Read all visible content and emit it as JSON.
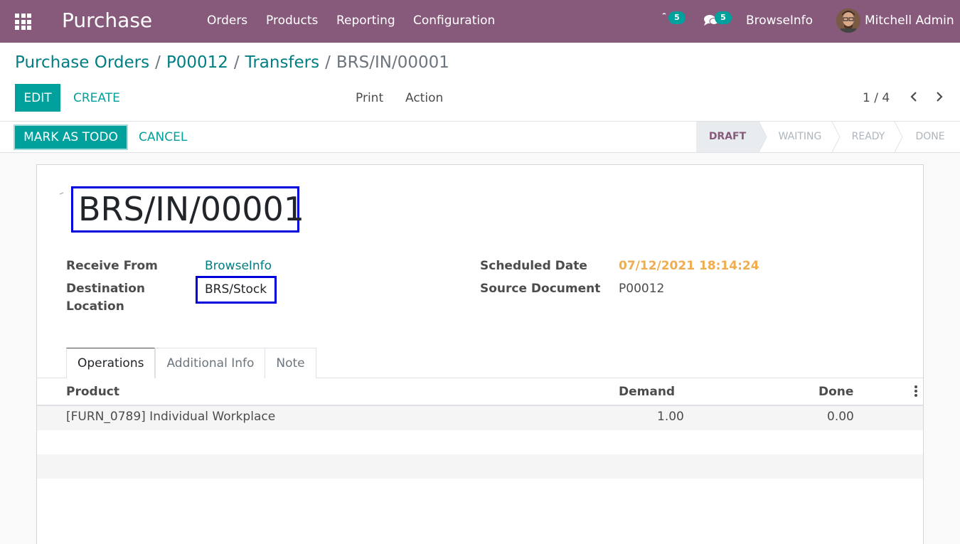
{
  "navbar": {
    "app_name": "Purchase",
    "menu": [
      "Orders",
      "Products",
      "Reporting",
      "Configuration"
    ],
    "activity_count": "5",
    "messages_count": "5",
    "company": "BrowseInfo",
    "user": "Mitchell Admin"
  },
  "breadcrumb": {
    "items": [
      "Purchase Orders",
      "P00012",
      "Transfers"
    ],
    "separator": "/",
    "current": "BRS/IN/00001"
  },
  "control_panel": {
    "edit_label": "EDIT",
    "create_label": "CREATE",
    "print_label": "Print",
    "action_label": "Action",
    "pager": "1 / 4"
  },
  "statusbar": {
    "mark_todo_label": "MARK AS TODO",
    "cancel_label": "CANCEL",
    "stages": [
      "DRAFT",
      "WAITING",
      "READY",
      "DONE"
    ],
    "active_stage": "DRAFT"
  },
  "form": {
    "title": "BRS/IN/00001",
    "receive_from_label": "Receive From",
    "receive_from_value": "BrowseInfo",
    "destination_label_1": "Destination",
    "destination_label_2": "Location",
    "destination_value": "BRS/Stock",
    "scheduled_date_label": "Scheduled Date",
    "scheduled_date_value": "07/12/2021 18:14:24",
    "source_document_label": "Source Document",
    "source_document_value": "P00012"
  },
  "tabs": [
    "Operations",
    "Additional Info",
    "Note"
  ],
  "table": {
    "headers": {
      "product": "Product",
      "demand": "Demand",
      "done": "Done"
    },
    "rows": [
      {
        "product": "[FURN_0789] Individual Workplace",
        "demand": "1.00",
        "done": "0.00"
      }
    ]
  },
  "colors": {
    "navbar": "#875a7b",
    "primary": "#00a09d",
    "link": "#017e84",
    "highlight_box": "#0000dd",
    "date": "#f0ad4e"
  }
}
